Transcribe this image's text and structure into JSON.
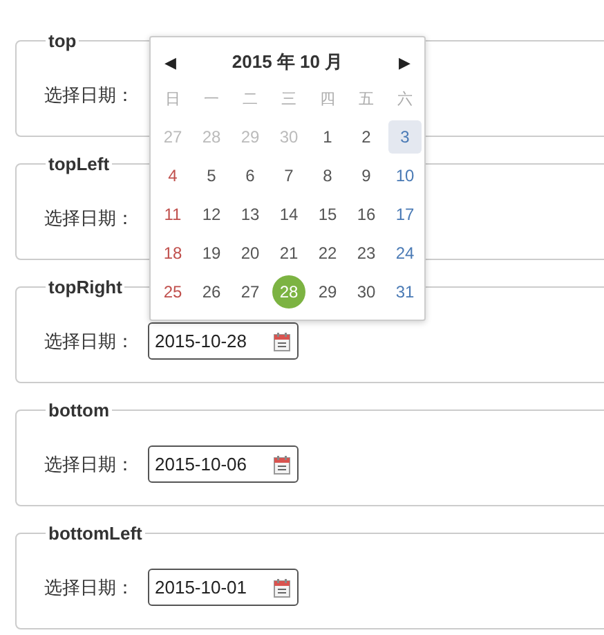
{
  "fields": [
    {
      "legend": "top",
      "label": "选择日期："
    },
    {
      "legend": "topLeft",
      "label": "选择日期："
    },
    {
      "legend": "topRight",
      "label": "选择日期：",
      "value": "2015-10-28"
    },
    {
      "legend": "bottom",
      "label": "选择日期：",
      "value": "2015-10-06"
    },
    {
      "legend": "bottomLeft",
      "label": "选择日期：",
      "value": "2015-10-01"
    }
  ],
  "calendar": {
    "prev": "◀",
    "title": "2015 年 10 月",
    "next": "▶",
    "weekdays": [
      "日",
      "一",
      "二",
      "三",
      "四",
      "五",
      "六"
    ],
    "days": [
      {
        "label": "27",
        "other_month": true,
        "selected": false,
        "highlighted": false
      },
      {
        "label": "28",
        "other_month": true,
        "selected": false,
        "highlighted": false
      },
      {
        "label": "29",
        "other_month": true,
        "selected": false,
        "highlighted": false
      },
      {
        "label": "30",
        "other_month": true,
        "selected": false,
        "highlighted": false
      },
      {
        "label": "1",
        "other_month": false,
        "selected": false,
        "highlighted": false
      },
      {
        "label": "2",
        "other_month": false,
        "selected": false,
        "highlighted": false
      },
      {
        "label": "3",
        "other_month": false,
        "selected": false,
        "highlighted": true
      },
      {
        "label": "4",
        "other_month": false,
        "selected": false,
        "highlighted": false
      },
      {
        "label": "5",
        "other_month": false,
        "selected": false,
        "highlighted": false
      },
      {
        "label": "6",
        "other_month": false,
        "selected": false,
        "highlighted": false
      },
      {
        "label": "7",
        "other_month": false,
        "selected": false,
        "highlighted": false
      },
      {
        "label": "8",
        "other_month": false,
        "selected": false,
        "highlighted": false
      },
      {
        "label": "9",
        "other_month": false,
        "selected": false,
        "highlighted": false
      },
      {
        "label": "10",
        "other_month": false,
        "selected": false,
        "highlighted": false
      },
      {
        "label": "11",
        "other_month": false,
        "selected": false,
        "highlighted": false
      },
      {
        "label": "12",
        "other_month": false,
        "selected": false,
        "highlighted": false
      },
      {
        "label": "13",
        "other_month": false,
        "selected": false,
        "highlighted": false
      },
      {
        "label": "14",
        "other_month": false,
        "selected": false,
        "highlighted": false
      },
      {
        "label": "15",
        "other_month": false,
        "selected": false,
        "highlighted": false
      },
      {
        "label": "16",
        "other_month": false,
        "selected": false,
        "highlighted": false
      },
      {
        "label": "17",
        "other_month": false,
        "selected": false,
        "highlighted": false
      },
      {
        "label": "18",
        "other_month": false,
        "selected": false,
        "highlighted": false
      },
      {
        "label": "19",
        "other_month": false,
        "selected": false,
        "highlighted": false
      },
      {
        "label": "20",
        "other_month": false,
        "selected": false,
        "highlighted": false
      },
      {
        "label": "21",
        "other_month": false,
        "selected": false,
        "highlighted": false
      },
      {
        "label": "22",
        "other_month": false,
        "selected": false,
        "highlighted": false
      },
      {
        "label": "23",
        "other_month": false,
        "selected": false,
        "highlighted": false
      },
      {
        "label": "24",
        "other_month": false,
        "selected": false,
        "highlighted": false
      },
      {
        "label": "25",
        "other_month": false,
        "selected": false,
        "highlighted": false
      },
      {
        "label": "26",
        "other_month": false,
        "selected": false,
        "highlighted": false
      },
      {
        "label": "27",
        "other_month": false,
        "selected": false,
        "highlighted": false
      },
      {
        "label": "28",
        "other_month": false,
        "selected": true,
        "highlighted": false
      },
      {
        "label": "29",
        "other_month": false,
        "selected": false,
        "highlighted": false
      },
      {
        "label": "30",
        "other_month": false,
        "selected": false,
        "highlighted": false
      },
      {
        "label": "31",
        "other_month": false,
        "selected": false,
        "highlighted": false
      }
    ]
  }
}
